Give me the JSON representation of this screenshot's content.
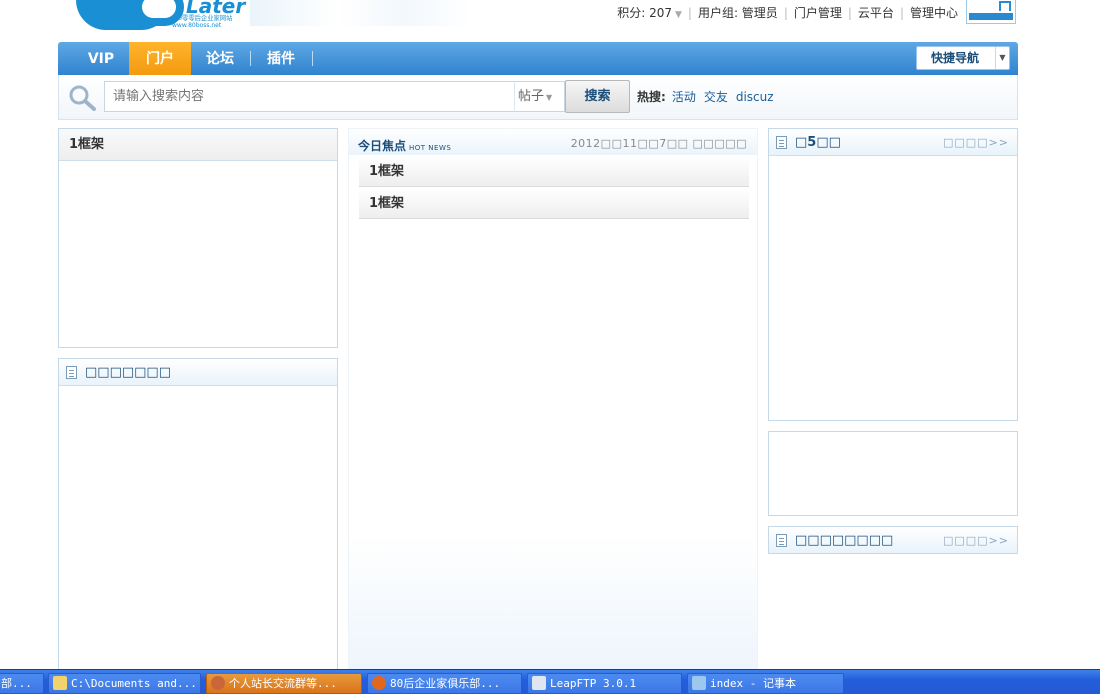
{
  "header": {
    "logo_word": "Later",
    "logo_tagline": "80零零后企业家网站",
    "logo_url": "www.80boss.net",
    "user_bar": {
      "points_label": "积分: 207",
      "user_group": "用户组: 管理员",
      "portal_admin": "门户管理",
      "cloud_platform": "云平台",
      "admin_center": "管理中心"
    }
  },
  "nav": {
    "items": [
      {
        "label": "VIP"
      },
      {
        "label": "门户",
        "active": true
      },
      {
        "label": "论坛"
      },
      {
        "label": "插件"
      }
    ],
    "quick_nav": "快捷导航"
  },
  "search": {
    "placeholder": "请输入搜索内容",
    "scope": "帖子",
    "button": "搜索",
    "hot_label": "热搜:",
    "hot_links": [
      "活动",
      "交友",
      "discuz"
    ]
  },
  "left": {
    "frame_title": "1框架",
    "panel2_title": "□□□□□□□"
  },
  "center": {
    "title": "今日焦点",
    "title_sub": "HOT NEWS",
    "date": "2012□□11□□7□□ □□□□□",
    "rows": [
      "1框架",
      "1框架"
    ]
  },
  "right": {
    "panel1_title": "□5□□",
    "panel1_more": "□□□□>>",
    "panel3_title": "□□□□□□□□",
    "panel3_more": "□□□□>>"
  },
  "taskbar": {
    "items": [
      {
        "label": "部..."
      },
      {
        "label": "C:\\Documents and..."
      },
      {
        "label": "个人站长交流群等...",
        "active": true
      },
      {
        "label": "80后企业家俱乐部..."
      },
      {
        "label": "LeapFTP 3.0.1"
      },
      {
        "label": "index - 记事本"
      }
    ]
  },
  "colors": {
    "nav_blue": "#2f83cf",
    "nav_active_orange": "#f39a10",
    "link_blue": "#1a5d9c",
    "taskbar_blue": "#245edb"
  }
}
